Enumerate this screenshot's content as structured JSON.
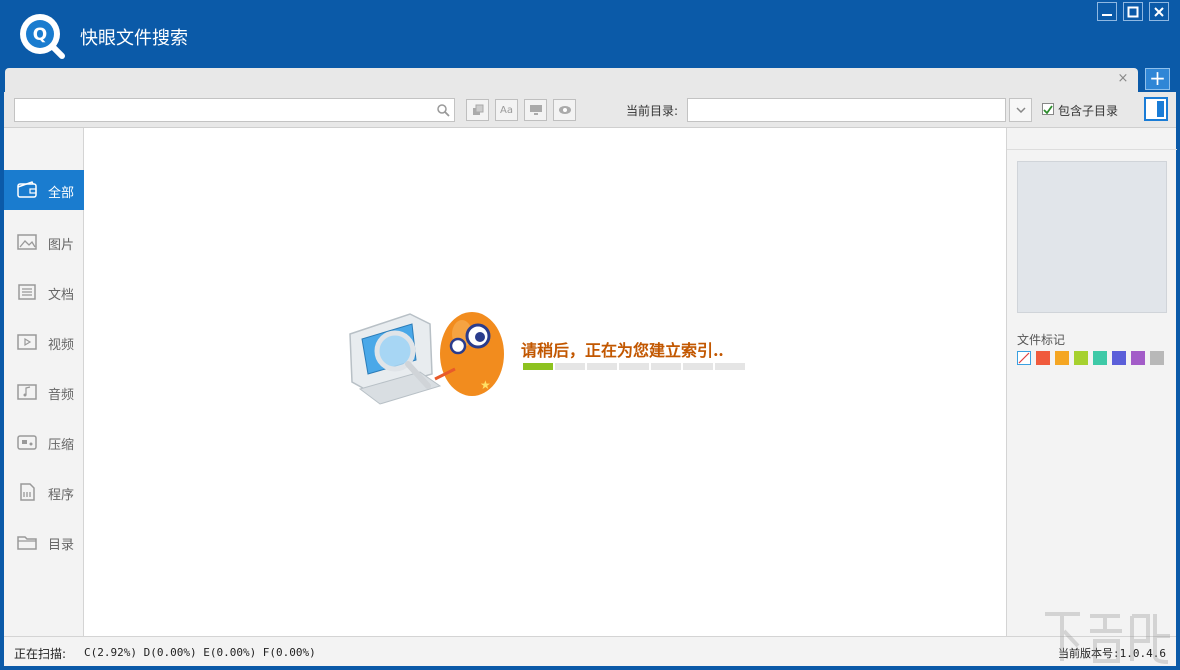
{
  "window": {
    "title": "快眼文件搜索",
    "controls": {
      "minimize": "—",
      "maximize": "□",
      "close": "✕"
    }
  },
  "tabs": {
    "close_glyph": "×",
    "add_glyph": "+"
  },
  "toolbar": {
    "search_value": "",
    "tool_aa_label": "Aa",
    "current_dir_label": "当前目录:",
    "current_dir_value": "",
    "include_subdirs_label": "包含子目录",
    "include_subdirs_checked": true
  },
  "sidebar": {
    "items": [
      {
        "label": "全部",
        "icon": "wallet-icon",
        "active": true
      },
      {
        "label": "图片",
        "icon": "picture-icon",
        "active": false
      },
      {
        "label": "文档",
        "icon": "document-icon",
        "active": false
      },
      {
        "label": "视频",
        "icon": "video-icon",
        "active": false
      },
      {
        "label": "音频",
        "icon": "music-icon",
        "active": false
      },
      {
        "label": "压缩",
        "icon": "archive-icon",
        "active": false
      },
      {
        "label": "程序",
        "icon": "program-icon",
        "active": false
      },
      {
        "label": "目录",
        "icon": "folder-icon",
        "active": false
      }
    ]
  },
  "main": {
    "message": "请稍后，正在为您建立索引‥",
    "progress": {
      "total_segments": 7,
      "filled_segments": 1
    }
  },
  "right_panel": {
    "marks_title": "文件标记",
    "swatches": [
      "none",
      "#f05a3c",
      "#f5a623",
      "#a6d12f",
      "#3ec9a7",
      "#5b5fd9",
      "#a35cc8",
      "#b8b8b8"
    ]
  },
  "status": {
    "scanning_label": "正在扫描:",
    "scanning_value": "C(2.92%) D(0.00%) E(0.00%) F(0.00%)",
    "version": "当前版本号:1.0.4.6"
  },
  "colors": {
    "brand_blue": "#0b5aa8",
    "active_blue": "#1a7ccf",
    "message_orange": "#c25700",
    "progress_green": "#8dc21f"
  }
}
